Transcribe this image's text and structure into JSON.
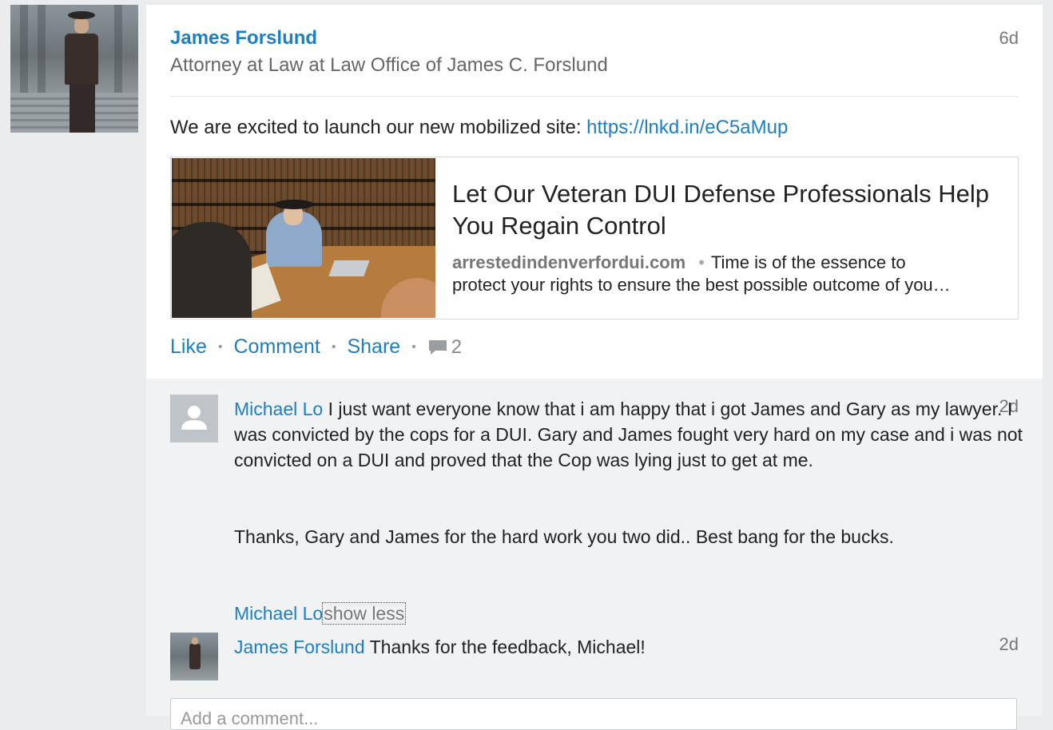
{
  "post": {
    "author_name": "James Forslund",
    "author_headline": "Attorney at Law at Law Office of James C. Forslund",
    "time": "6d",
    "text": "We are excited to launch our new mobilized site: ",
    "link_text": "https://lnkd.in/eC5aMup",
    "link_card": {
      "title": "Let Our Veteran DUI Defense Professionals Help You Regain Control",
      "domain": "arrestedindenverfordui.com",
      "separator": "•",
      "desc_part1": "Time is of the essence to",
      "desc_part2": "protect your rights to ensure the best possible outcome of you…"
    },
    "actions": {
      "like": "Like",
      "comment": "Comment",
      "share": "Share",
      "sep": "•",
      "comment_count": "2"
    }
  },
  "comments": [
    {
      "name": "Michael Lo",
      "time": "2d",
      "text": "I just want everyone know that i am happy that i got James and Gary as my lawyer. I was convicted by the cops for a DUI. Gary and James fought very hard on my case and i was not convicted on a DUI and proved that the Cop was lying just to get at me.",
      "text2": "Thanks, Gary and James for the hard work you two did.. Best bang for the bucks.",
      "signature": "Michael Lo",
      "show_less": "show less"
    },
    {
      "name": "James Forslund",
      "time": "2d",
      "text": "Thanks for the feedback, Michael!"
    }
  ],
  "comment_input": {
    "placeholder": "Add a comment..."
  },
  "colors": {
    "link_blue": "#1d7fbf",
    "page_bg": "#eaecee",
    "comments_bg": "#f0f2f4"
  }
}
